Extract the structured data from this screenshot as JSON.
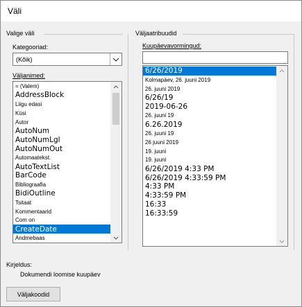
{
  "window": {
    "title": "Väli"
  },
  "left": {
    "group_label": "Valige väli",
    "category_label": "Kategooriad:",
    "category_value": "(Kõik)",
    "fieldnames_label": "Väljanimed:",
    "items": [
      {
        "label": "= (Valem)",
        "size": "small"
      },
      {
        "label": "AddressBlock",
        "size": "big"
      },
      {
        "label": "Liigu edasi",
        "size": "small"
      },
      {
        "label": "Küsi",
        "size": "small"
      },
      {
        "label": "Autor",
        "size": "small"
      },
      {
        "label": "AutoNum",
        "size": "big"
      },
      {
        "label": "AutoNumLgl",
        "size": "big"
      },
      {
        "label": "AutoNumOut",
        "size": "big"
      },
      {
        "label": "Automaatekst.",
        "size": "small"
      },
      {
        "label": "AutoTextList",
        "size": "big"
      },
      {
        "label": "BarCode",
        "size": "big"
      },
      {
        "label": "Bibliograafia",
        "size": "small"
      },
      {
        "label": "BidiOutline",
        "size": "big"
      },
      {
        "label": "Tsitaat",
        "size": "small"
      },
      {
        "label": "Kommentaarid",
        "size": "small"
      },
      {
        "label": "Com on",
        "size": "small"
      },
      {
        "label": "CreateDate",
        "size": "big",
        "selected": true
      },
      {
        "label": "Andmebaas",
        "size": "small"
      }
    ]
  },
  "right": {
    "group_label": "Väljaatribuudid",
    "formats_label": "Kuupäevavormingud:",
    "formats_input_value": "",
    "formats": [
      {
        "label": "6/26/2019",
        "size": "big",
        "selected": true
      },
      {
        "label": "Kolmapäev, 26. juuni 2019",
        "size": "small"
      },
      {
        "label": "26. juuni 2019",
        "size": "small"
      },
      {
        "label": "6/26/19",
        "size": "big"
      },
      {
        "label": "2019-06-26",
        "size": "big"
      },
      {
        "label": "26. juuni 19",
        "size": "small"
      },
      {
        "label": "6.26.2019",
        "size": "big"
      },
      {
        "label": "26. juuni 19",
        "size": "small"
      },
      {
        "label": "26 juuni 2019",
        "size": "small"
      },
      {
        "label": "19. juuni",
        "size": "small"
      },
      {
        "label": "19. juuni",
        "size": "small"
      },
      {
        "label": "6/26/2019 4:33 PM",
        "size": "big"
      },
      {
        "label": "6/26/2019 4:33:59 PM",
        "size": "big"
      },
      {
        "label": "4:33 PM",
        "size": "big"
      },
      {
        "label": "4:33:59 PM",
        "size": "big"
      },
      {
        "label": "16:33",
        "size": "big"
      },
      {
        "label": "16:33:59",
        "size": "big"
      }
    ]
  },
  "description": {
    "label": "Kirjeldus:",
    "text": "Dokumendi loomise kuupäev"
  },
  "buttons": {
    "field_codes": "Väljakoodid"
  }
}
